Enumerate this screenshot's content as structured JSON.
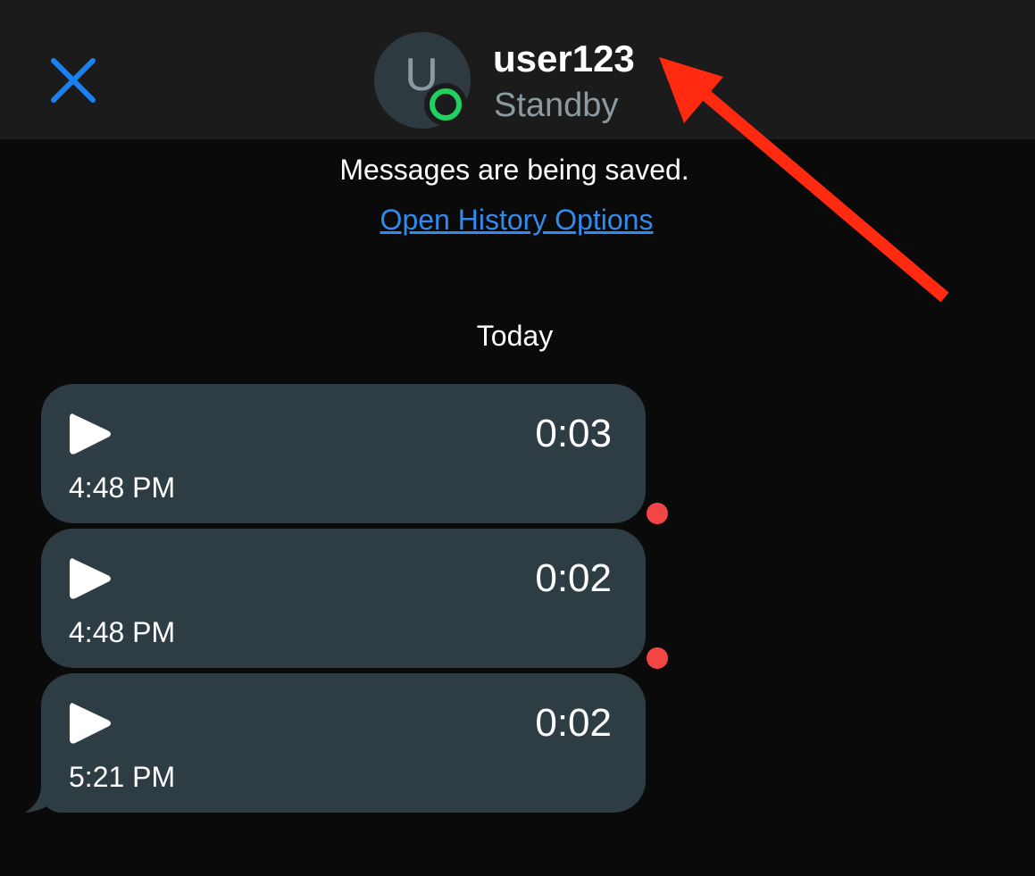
{
  "header": {
    "username": "user123",
    "status": "Standby",
    "avatar_initial": "U",
    "presence_color": "#1fd160",
    "close_color": "#1a82f0"
  },
  "notice": {
    "text": "Messages are being saved.",
    "link_label": "Open History Options",
    "link_color": "#2f8bf0"
  },
  "date_separator": "Today",
  "messages": [
    {
      "duration": "0:03",
      "time": "4:48 PM",
      "unread_dot": true
    },
    {
      "duration": "0:02",
      "time": "4:48 PM",
      "unread_dot": true
    },
    {
      "duration": "0:02",
      "time": "5:21 PM",
      "unread_dot": false
    }
  ],
  "colors": {
    "background": "#0a0a0a",
    "header_background": "#1b1b1b",
    "bubble": "#2e3c44",
    "unread_dot": "#f24545",
    "annotation_arrow": "#ff2a10"
  },
  "icons": {
    "close": "close-icon",
    "play": "play-icon",
    "presence": "presence-ring-icon"
  }
}
